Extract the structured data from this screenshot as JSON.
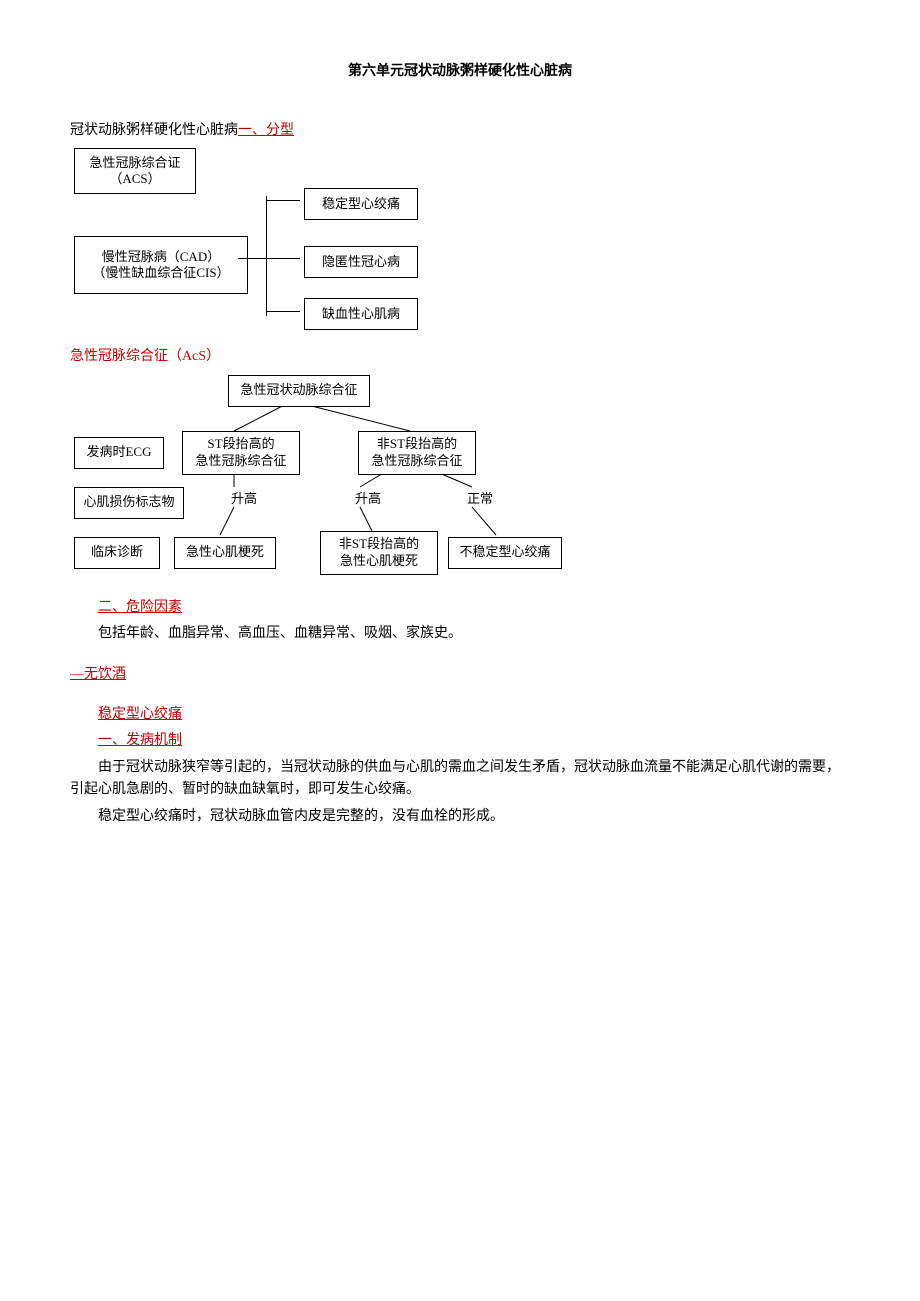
{
  "title": "第六单元冠状动脉粥样硬化性心脏病",
  "intro_prefix": "冠状动脉粥样硬化性心脏病",
  "intro_link": "一、分型",
  "diagram1": {
    "acs": "急性冠脉综合证\n（ACS）",
    "cad_line1": "慢性冠脉病（CAD）",
    "cad_line2": "（慢性缺血综合征CIS）",
    "r1": "稳定型心绞痛",
    "r2": "隐匿性冠心病",
    "r3": "缺血性心肌病"
  },
  "acs_heading": "急性冠脉综合征（AcS）",
  "diagram2": {
    "top": "急性冠状动脉综合征",
    "ecg": "发病时ECG",
    "stUp_line1": "ST段抬高的",
    "stUp_line2": "急性冠脉综合征",
    "stNo_line1": "非ST段抬高的",
    "stNo_line2": "急性冠脉综合征",
    "marker": "心肌损伤标志物",
    "up": "升高",
    "normal": "正常",
    "diag": "临床诊断",
    "ami": "急性心肌梗死",
    "nste_line1": "非ST段抬高的",
    "nste_line2": "急性心肌梗死",
    "uap": "不稳定型心绞痛"
  },
  "risk_heading": "二、危险因素",
  "risk_text": "包括年龄、血脂异常、高血压、血糖异常、吸烟、家族史。",
  "no_alcohol": "—无饮酒",
  "stable_heading": "稳定型心绞痛",
  "mech_heading": "一、发病机制",
  "mech_p1": "由于冠状动脉狭窄等引起的，当冠状动脉的供血与心肌的需血之间发生矛盾，冠状动脉血流量不能满足心肌代谢的需要，引起心肌急剧的、暂时的缺血缺氧时，即可发生心绞痛。",
  "mech_p2": "稳定型心绞痛时，冠状动脉血管内皮是完整的，没有血栓的形成。"
}
